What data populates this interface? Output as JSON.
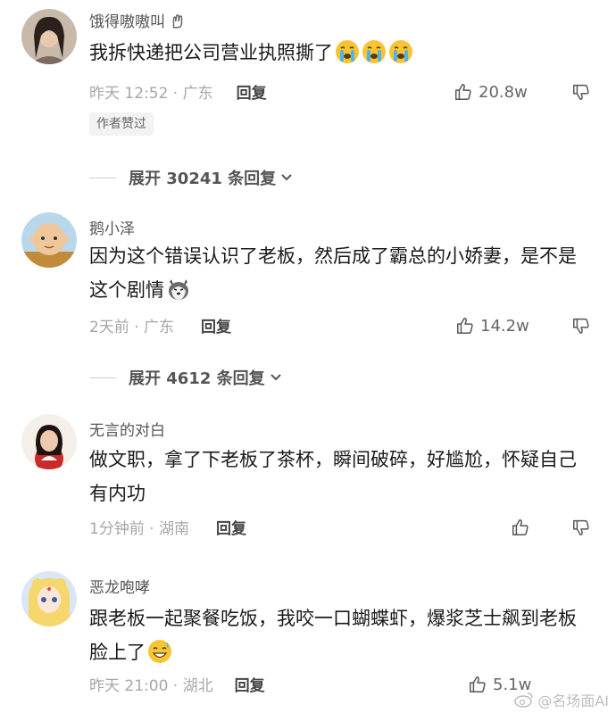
{
  "comments": [
    {
      "username": "饿得嗷嗷叫",
      "text": "我拆快递把公司营业执照撕了",
      "emojis": [
        "crying-emoji",
        "crying-emoji",
        "crying-emoji"
      ],
      "time_location": "昨天 12:52 · 广东",
      "reply_label": "回复",
      "like_count": "20.8w",
      "badge": "作者赞过",
      "expand_label": "展开 30241 条回复"
    },
    {
      "username": "鹅小泽",
      "text": "因为这个错误认识了老板，然后成了霸总的小娇妻，是不是这个剧情",
      "emojis": [
        "husky-emoji"
      ],
      "time_location": "2天前 · 广东",
      "reply_label": "回复",
      "like_count": "14.2w",
      "expand_label": "展开 4612 条回复"
    },
    {
      "username": "无言的对白",
      "text": "做文职，拿了下老板了茶杯，瞬间破碎，好尴尬，怀疑自己有内功",
      "time_location": "1分钟前 · 湖南",
      "reply_label": "回复",
      "like_count": ""
    },
    {
      "username": "恶龙咆哮",
      "text": "跟老板一起聚餐吃饭，我咬一口蝴蝶虾，爆浆芝士飙到老板脸上了",
      "emojis": [
        "sweat-grin-emoji"
      ],
      "time_location": "昨天 21:00 · 湖北",
      "reply_label": "回复",
      "like_count": "5.1w"
    }
  ],
  "watermark": "@名场面AI",
  "colors": {
    "meta": "#a6a6a6",
    "text": "#1a1a1a",
    "badge_bg": "#f2f2f2"
  }
}
